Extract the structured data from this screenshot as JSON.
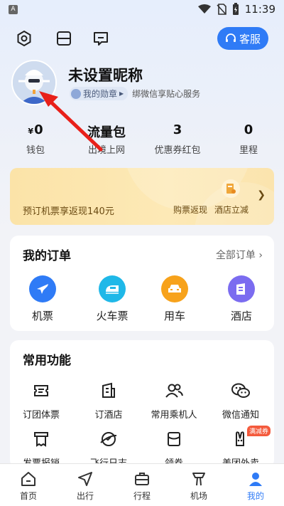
{
  "status_bar": {
    "app_letter": "A",
    "time": "11:39"
  },
  "header": {
    "service_label": "客服"
  },
  "profile": {
    "nickname": "未设置昵称",
    "badge_label": "我的勋章",
    "wechat_text": "绑微信享贴心服务"
  },
  "stats": [
    {
      "unit": "¥",
      "value": "0",
      "label": "钱包"
    },
    {
      "unit": "",
      "value": "流量包",
      "label": "出境上网"
    },
    {
      "unit": "",
      "value": "3",
      "label": "优惠券红包"
    },
    {
      "unit": "",
      "value": "0",
      "label": "里程"
    }
  ],
  "promo": {
    "text": "预订机票享返现140元",
    "item1": "购票返现",
    "item2": "酒店立减"
  },
  "orders": {
    "title": "我的订单",
    "more": "全部订单",
    "items": [
      {
        "label": "机票",
        "icon": "plane-icon",
        "color": "#2f7bf6"
      },
      {
        "label": "火车票",
        "icon": "train-icon",
        "color": "#1fb8e8"
      },
      {
        "label": "用车",
        "icon": "car-icon",
        "color": "#f7a21b"
      },
      {
        "label": "酒店",
        "icon": "hotel-icon",
        "color": "#7b6cf0"
      }
    ]
  },
  "functions": {
    "title": "常用功能",
    "items": [
      {
        "label": "订团体票",
        "icon": "group-ticket-icon"
      },
      {
        "label": "订酒店",
        "icon": "hotel-book-icon"
      },
      {
        "label": "常用乘机人",
        "icon": "passengers-icon"
      },
      {
        "label": "微信通知",
        "icon": "wechat-icon"
      },
      {
        "label": "发票报销",
        "icon": "invoice-icon"
      },
      {
        "label": "飞行日志",
        "icon": "flight-log-icon"
      },
      {
        "label": "领券",
        "icon": "coupon-icon"
      },
      {
        "label": "美团外卖",
        "icon": "meituan-icon",
        "tag": "满减券"
      }
    ]
  },
  "tabs": [
    {
      "label": "首页",
      "icon": "home-icon"
    },
    {
      "label": "出行",
      "icon": "navigate-icon"
    },
    {
      "label": "行程",
      "icon": "suitcase-icon"
    },
    {
      "label": "机场",
      "icon": "airport-icon"
    },
    {
      "label": "我的",
      "icon": "user-icon"
    }
  ]
}
